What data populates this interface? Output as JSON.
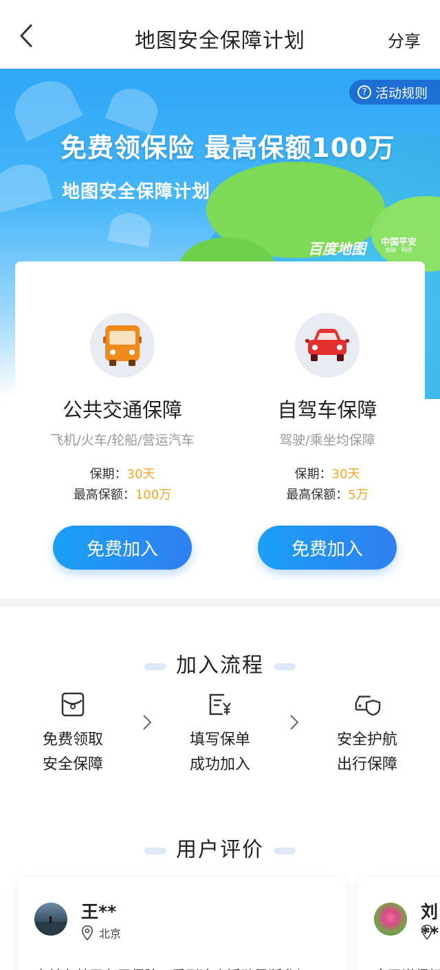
{
  "nav": {
    "title": "地图安全保障计划",
    "share": "分享"
  },
  "banner": {
    "rules": "活动规则",
    "headline": "免费领保险 最高保额100万",
    "subhead": "地图安全保障计划",
    "brand_baidu": "百度地图",
    "brand_pingan": "中国平安",
    "brand_pingan_small": "金融 · 科技"
  },
  "plans": [
    {
      "name": "公共交通保障",
      "sub": "飞机/火车/轮船/营运汽车",
      "period_label": "保期：",
      "period_value": "30天",
      "max_label": "最高保额：",
      "max_value": "100万",
      "button": "免费加入",
      "icon": "bus-icon",
      "color": "#f08a1c"
    },
    {
      "name": "自驾车保障",
      "sub": "驾驶/乘坐均保障",
      "period_label": "保期：",
      "period_value": "30天",
      "max_label": "最高保额：",
      "max_value": "5万",
      "button": "免费加入",
      "icon": "car-icon",
      "color": "#e33131"
    }
  ],
  "process": {
    "title": "加入流程",
    "steps": [
      {
        "line1": "免费领取",
        "line2": "安全保障",
        "icon": "wallet-icon"
      },
      {
        "line1": "填写保单",
        "line2": "成功加入",
        "icon": "form-yuan-icon"
      },
      {
        "line1": "安全护航",
        "line2": "出行保障",
        "icon": "car-shield-icon"
      }
    ]
  },
  "reviews": {
    "title": "用户评价",
    "items": [
      {
        "name": "王**",
        "city": "北京",
        "text": "之前在某平台买保险，看到这个活动果断参加"
      },
      {
        "name": "刘**",
        "city": "",
        "text": "今天说得好"
      }
    ]
  }
}
